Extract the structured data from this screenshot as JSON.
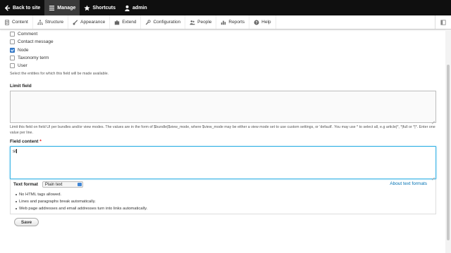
{
  "toolbar": {
    "back": "Back to site",
    "manage": "Manage",
    "shortcuts": "Shortcuts",
    "user": "admin"
  },
  "tray": {
    "items": [
      "Content",
      "Structure",
      "Appearance",
      "Extend",
      "Configuration",
      "People",
      "Reports",
      "Help"
    ]
  },
  "entities": {
    "options": [
      {
        "label": "Comment",
        "checked": false
      },
      {
        "label": "Contact message",
        "checked": false
      },
      {
        "label": "Node",
        "checked": true
      },
      {
        "label": "Taxonomy term",
        "checked": false
      },
      {
        "label": "User",
        "checked": false
      }
    ],
    "description": "Select the entities for which this field will be made available."
  },
  "limit_field": {
    "label": "Limit field",
    "value": "",
    "description": "Limit this field on field UI per bundles and/or view modes. The values are in the form of $bundle|$view_mode, where $view_mode may be either a view mode set to use custom settings, or 'default'. You may use * to select all, e.g article|*, *|full or *|*. Enter one value per line."
  },
  "field_content": {
    "label": "Field content",
    "required_mark": "*",
    "value": "st"
  },
  "text_format": {
    "label": "Text format",
    "selected": "Plain text",
    "about_link": "About text formats",
    "tips": [
      "No HTML tags allowed.",
      "Lines and paragraphs break automatically.",
      "Web page addresses and email addresses turn into links automatically."
    ]
  },
  "actions": {
    "save": "Save"
  },
  "colors": {
    "toolbar_bg": "#0f0f0f",
    "focus_border": "#40b6e6",
    "link": "#0071b3",
    "checkbox_checked": "#3f86d6"
  }
}
